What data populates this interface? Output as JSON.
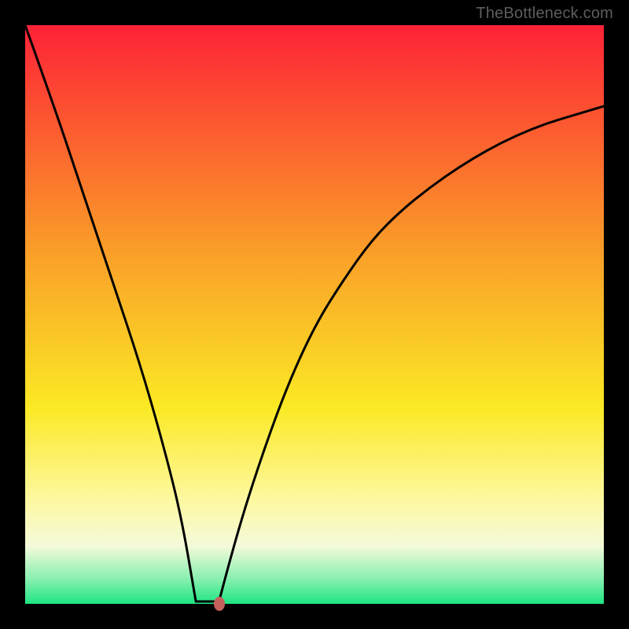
{
  "watermark": "TheBottleneck.com",
  "colors": {
    "red_top": "#fd2236",
    "orange": "#faa128",
    "yellow": "#fbe924",
    "yellow_white": "#fdf8a0",
    "pale": "#f4fada",
    "teal_light": "#8cf0b2",
    "green_bottom": "#1ee583",
    "frame": "#000000",
    "curve": "#000000",
    "marker": "#c4605b",
    "watermark_text": "#5d5d5d"
  },
  "chart_data": {
    "type": "line",
    "title": "",
    "xlabel": "",
    "ylabel": "",
    "xlim": [
      0,
      100
    ],
    "ylim": [
      0,
      100
    ],
    "series": [
      {
        "name": "bottleneck-curve",
        "x": [
          0,
          5,
          10,
          15,
          20,
          24,
          27,
          30,
          31.5,
          33,
          36,
          40,
          45,
          50,
          55,
          60,
          65,
          70,
          75,
          80,
          85,
          90,
          95,
          100
        ],
        "values": [
          100,
          86,
          71,
          56,
          41,
          27,
          15,
          5,
          0.5,
          0.8,
          10,
          23,
          37,
          48,
          56,
          63,
          68,
          72,
          75.5,
          78.5,
          81,
          83,
          84.5,
          86
        ]
      }
    ],
    "flat_segment": {
      "x_start": 29.5,
      "x_end": 33.5,
      "y": 0.4
    },
    "marker": {
      "x": 33.5,
      "y": 0.0
    },
    "gradient_stops_vertical": [
      {
        "pos": 0.0,
        "color": "#fd2236"
      },
      {
        "pos": 0.4,
        "color": "#faa128"
      },
      {
        "pos": 0.66,
        "color": "#fbe924"
      },
      {
        "pos": 0.82,
        "color": "#fdf8a0"
      },
      {
        "pos": 0.9,
        "color": "#f4fada"
      },
      {
        "pos": 0.955,
        "color": "#8cf0b2"
      },
      {
        "pos": 1.0,
        "color": "#1ee583"
      }
    ]
  }
}
